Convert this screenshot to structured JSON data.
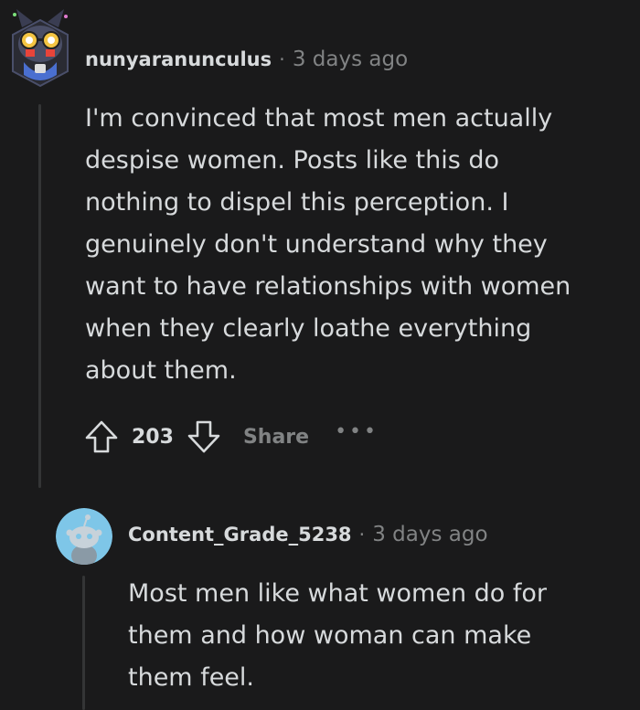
{
  "comments": [
    {
      "username": "nunyaranunculus",
      "separator": "·",
      "time": "3 days ago",
      "body_lines": [
        "I'm convinced that most men actually",
        "despise women. Posts like this do",
        "nothing to dispel this perception. I",
        "genuinely don't understand why they",
        "want to have relationships with women",
        "when they clearly loathe everything",
        "about them."
      ],
      "score": "203",
      "share_label": "Share",
      "more_label": "•••"
    },
    {
      "username": "Content_Grade_5238",
      "separator": "·",
      "time": "3 days ago",
      "body_lines": [
        "Most men like what women do for",
        "them and how woman can make",
        "them feel."
      ]
    }
  ],
  "icons": {
    "upvote": "upvote-arrow-icon",
    "downvote": "downvote-arrow-icon",
    "more": "more-options-icon"
  },
  "colors": {
    "background": "#1a1a1b",
    "text": "#d7dadc",
    "muted": "#818384",
    "thread_line": "#343536",
    "avatar2_bg": "#7ec6e8"
  }
}
